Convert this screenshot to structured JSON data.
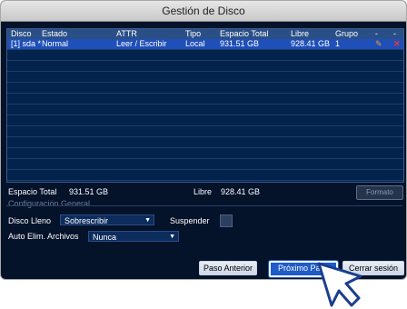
{
  "window": {
    "title": "Gestión de Disco"
  },
  "table": {
    "headers": [
      "Disco",
      "Estado",
      "ATTR",
      "Tipo",
      "Espacio Total",
      "Libre",
      "Grupo",
      "-",
      "-"
    ],
    "rows": [
      {
        "disco": "[1] sda *",
        "estado": "Normal",
        "attr": "Leer / Escribir",
        "tipo": "Local",
        "espacio_total": "931.51 GB",
        "libre": "928.41 GB",
        "grupo": "1",
        "edit_icon": "pencil-icon",
        "delete_icon": "x-icon"
      }
    ]
  },
  "summary": {
    "total_label": "Espacio Total",
    "total_value": "931.51 GB",
    "free_label": "Libre",
    "free_value": "928.41 GB",
    "format_button": "Formato"
  },
  "config": {
    "section_label": "Configuración General",
    "disk_full_label": "Disco Lleno",
    "disk_full_value": "Sobrescribir",
    "suspend_label": "Suspender",
    "suspend_checked": false,
    "auto_delete_label": "Auto Elim. Archivos",
    "auto_delete_value": "Nunca"
  },
  "buttons": {
    "previous": "Paso Anterior",
    "next": "Próximo Paso",
    "logout": "Cerrar sesión"
  },
  "colors": {
    "background": "#04122a",
    "header": "#2a4f86",
    "selected_row": "#1f4fb8",
    "primary_button": "#1f5bc9"
  }
}
